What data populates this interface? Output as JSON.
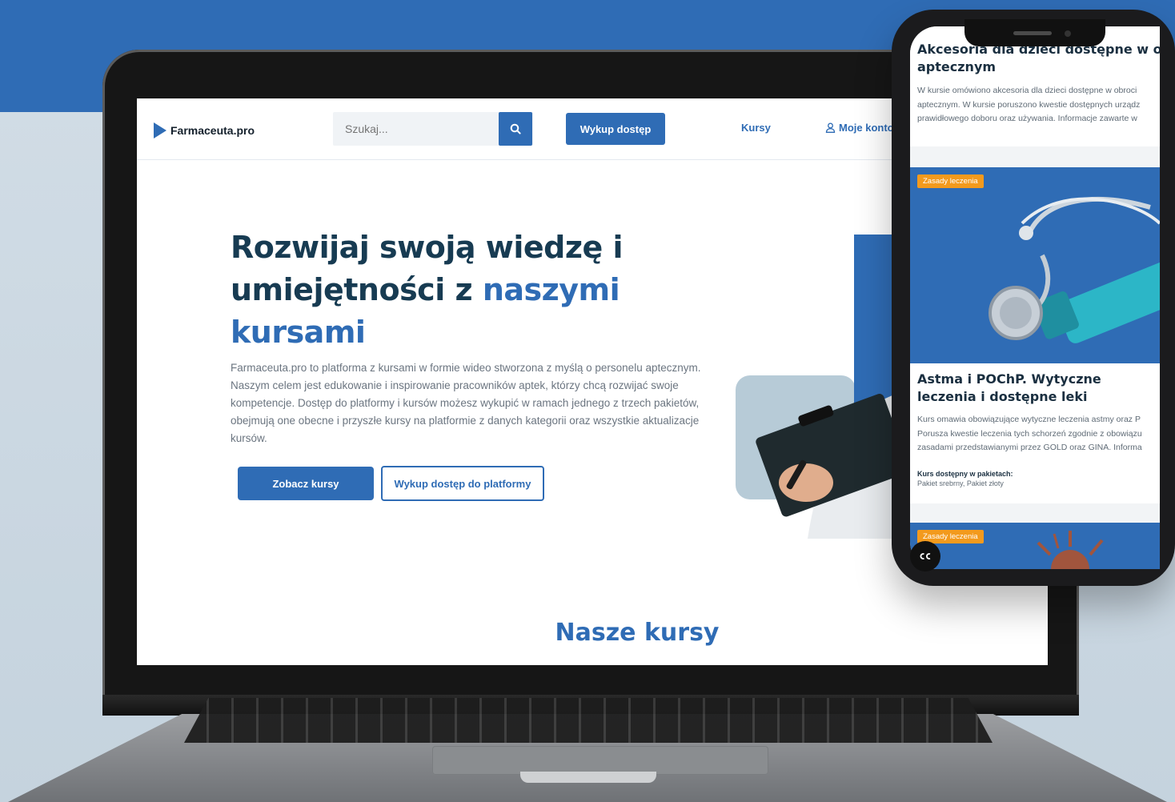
{
  "colors": {
    "brand_blue": "#2f6cb5",
    "dark_navy": "#173b52",
    "tag_orange": "#f39a1d"
  },
  "website": {
    "logo": "Farmaceuta.pro",
    "search": {
      "placeholder": "Szukaj..."
    },
    "nav": {
      "buy_label": "Wykup dostęp",
      "courses_label": "Kursy",
      "account_label": "Moje konto"
    },
    "hero": {
      "title_part1": "Rozwijaj swoją wiedzę i umiejętności z ",
      "title_accent": "naszymi kursami",
      "description": "Farmaceuta.pro to platforma z kursami w formie wideo stworzona z myślą o personelu aptecznym. Naszym celem jest edukowanie i inspirowanie pracowników aptek, którzy chcą rozwijać swoje kompetencje. Dostęp do platformy i kursów możesz wykupić w ramach jednego z trzech pakietów, obejmują one obecne i przyszłe kursy na platformie z danych kategorii oraz wszystkie aktualizacje kursów.",
      "primary_button": "Zobacz kursy",
      "secondary_button": "Wykup dostęp do platformy"
    },
    "section_title": "Nasze kursy"
  },
  "phone": {
    "card1": {
      "title_line1": "Akcesoria dla dzieci dostępne w obroci",
      "title_line2": "aptecznym",
      "text_line1": "W kursie omówiono akcesoria dla dzieci dostępne w obroci",
      "text_line2": "aptecznym. W kursie poruszono kwestie dostępnych urządz",
      "text_line3": "prawidłowego doboru oraz używania.  Informacje zawarte w"
    },
    "card2": {
      "tag": "Zasady leczenia",
      "title": "Astma i POChP. Wytyczne leczenia i dostępne leki",
      "text_line1": "Kurs omawia obowiązujące wytyczne leczenia astmy oraz P",
      "text_line2": "Porusza kwestie leczenia tych schorzeń zgodnie z obowiązu",
      "text_line3": "zasadami przedstawianymi przez GOLD oraz GINA. Informa",
      "packages_label": "Kurs dostępny w pakietach:",
      "packages_value": "Pakiet srebrny, Pakiet złoty"
    },
    "card3": {
      "tag": "Zasady leczenia"
    },
    "cc_icon": "closed-captions-icon"
  }
}
